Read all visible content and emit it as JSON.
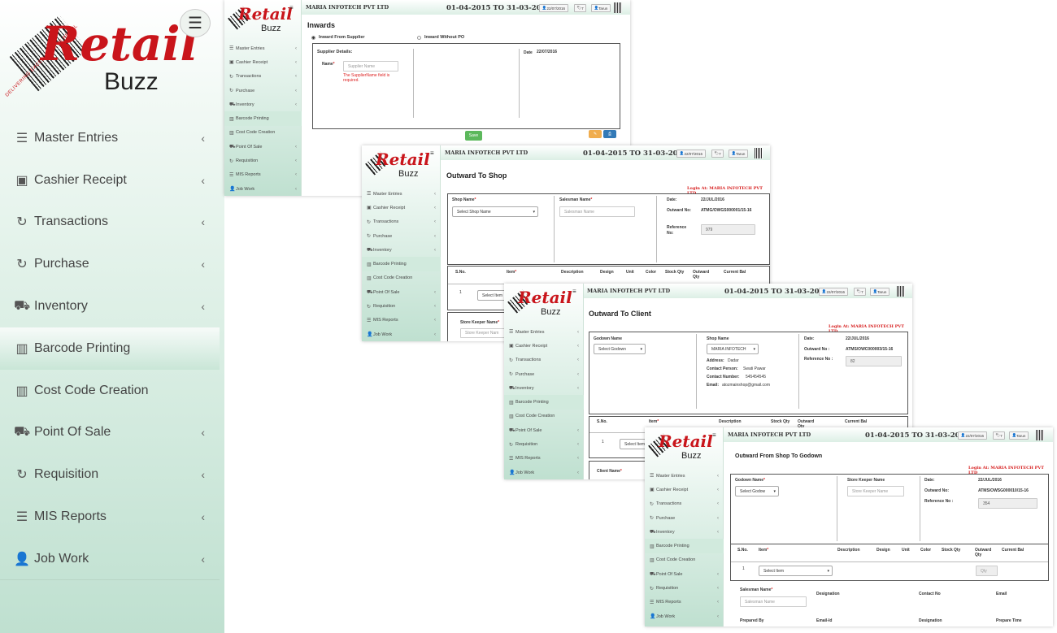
{
  "brand": {
    "retail": "Retail",
    "buzz": "Buzz",
    "tagline": "DELIVERING EXCELLENCE IN RETAIL"
  },
  "menu_icon": "hamburger-icon",
  "sidebar": {
    "items": [
      {
        "label": "Master Entries",
        "icon": "list-icon",
        "glyph": "☰",
        "chevron": true
      },
      {
        "label": "Cashier Receipt",
        "icon": "money-icon",
        "glyph": "▣",
        "chevron": true
      },
      {
        "label": "Transactions",
        "icon": "refresh-icon",
        "glyph": "↻",
        "chevron": true
      },
      {
        "label": "Purchase",
        "icon": "refresh-icon",
        "glyph": "↻",
        "chevron": true
      },
      {
        "label": "Inventory",
        "icon": "cart-icon",
        "glyph": "⛟",
        "chevron": true
      },
      {
        "label": "Barcode Printing",
        "icon": "barcode-icon",
        "glyph": "▥",
        "chevron": false
      },
      {
        "label": "Cost Code Creation",
        "icon": "barcode-icon",
        "glyph": "▥",
        "chevron": false
      },
      {
        "label": "Point Of Sale",
        "icon": "cart-icon",
        "glyph": "⛟",
        "chevron": true
      },
      {
        "label": "Requisition",
        "icon": "refresh-icon",
        "glyph": "↻",
        "chevron": true
      },
      {
        "label": "MIS Reports",
        "icon": "list-icon",
        "glyph": "☰",
        "chevron": true
      },
      {
        "label": "Job Work",
        "icon": "user-icon",
        "glyph": "👤",
        "chevron": true
      }
    ],
    "chevron_glyph": "‹",
    "active_index": 5
  },
  "header": {
    "company": "MARIA INFOTECH PVT LTD",
    "fy": "01-04-2015 TO 31-03-2016",
    "date_chip": "22/07/2016",
    "tag_chip": "7",
    "user_chip": "Tarun"
  },
  "inwards": {
    "title": "Inwards",
    "radio_supplier": "Inward From Supplier",
    "radio_without_po": "Inward Without PO",
    "supplier_details": "Supplier Details:",
    "name_label": "Name",
    "name_placeholder": "Supplier Name",
    "error": "The SupplierName field is required.",
    "date_label": "Date",
    "date_value": "22/07/2016",
    "save": "Save"
  },
  "outward_shop": {
    "title": "Outward To Shop",
    "login_at": "Login At: MARIA INFOTECH PVT LTD",
    "shop_name_label": "Shop Name",
    "shop_select": "Select Shop Name",
    "salesman_label": "Salesman Name",
    "salesman_placeholder": "Salesman Name",
    "date_label": "Date:",
    "date_value": "22/JUL/2016",
    "outward_no_label": "Outward No:",
    "outward_no_value": "ATMG/OWGS000001/15-16",
    "reference_label": "Reference No:",
    "reference_value": "979",
    "columns": [
      "S.No.",
      "Item",
      "Description",
      "Design",
      "Unit",
      "Color",
      "Stock Qty",
      "Outward Qty",
      "Current Bal"
    ],
    "row_no": "1",
    "item_select": "Select Item",
    "store_keeper_label": "Store Keeper Name",
    "store_keeper_placeholder": "Store Keeper Nam"
  },
  "outward_client": {
    "title": "Outward To Client",
    "login_at": "Login At: MARIA INFOTECH PVT LTD",
    "godown_label": "Godown Name",
    "godown_select": "Select Godown",
    "shop_label": "Shop Name",
    "shop_select": "MARIA INFOTECH",
    "address_label": "Address:",
    "address_value": "Dadar",
    "contact_person_label": "Contact Person:",
    "contact_person_value": "Swati Pawar",
    "contact_number_label": "Contact Number:",
    "contact_number_value": "545454545",
    "email_label": "Email:",
    "email_value": "atozmainshop@gmail.com",
    "date_label": "Date:",
    "date_value": "22/JUL/2016",
    "outward_no_label": "Outward No :",
    "outward_no_value": "ATMS/OWC000003/15-16",
    "reference_label": "Reference No :",
    "reference_value": "82",
    "columns": [
      "S.No.",
      "Item",
      "Description",
      "Stock Qty",
      "Outward Qty",
      "Current Bal"
    ],
    "row_no": "1",
    "item_select": "Select Item",
    "client_label": "Client Name"
  },
  "outward_godown": {
    "title": "Outward From Shop To Godown",
    "login_at": "Login At: MARIA INFOTECH PVT LTD",
    "godown_label": "Godown Name",
    "godown_select": "Select Godow",
    "store_keeper_label": "Store Keeper Name",
    "store_keeper_placeholder": "Store Keeper Name",
    "date_label": "Date:",
    "date_value": "22/JUL/2016",
    "outward_no_label": "Outward No:",
    "outward_no_value": "ATMS/OWSG000010/15-16",
    "reference_label": "Reference No :",
    "reference_value": "354",
    "columns": [
      "S.No.",
      "Item",
      "Description",
      "Design",
      "Unit",
      "Color",
      "Stock Qty",
      "Outward Qty",
      "Current Bal"
    ],
    "row_no": "1",
    "item_select": "Select Item",
    "qty_placeholder": "Qty",
    "salesman_label": "Salesman Name",
    "salesman_placeholder": "Salesman Name",
    "designation_label": "Designation",
    "contact_no_label": "Contact No",
    "email_label": "Email",
    "prepared_by_label": "Prepared By",
    "email_id_label": "Email-Id",
    "designation2_label": "Designation",
    "prepare_time_label": "Prepare Time"
  },
  "colors": {
    "accent_green": "#5cb85c",
    "warning": "#f0ad4e",
    "primary": "#337ab7",
    "brand_red": "#c9151b",
    "sidebar_green": "#bfe0d0"
  }
}
